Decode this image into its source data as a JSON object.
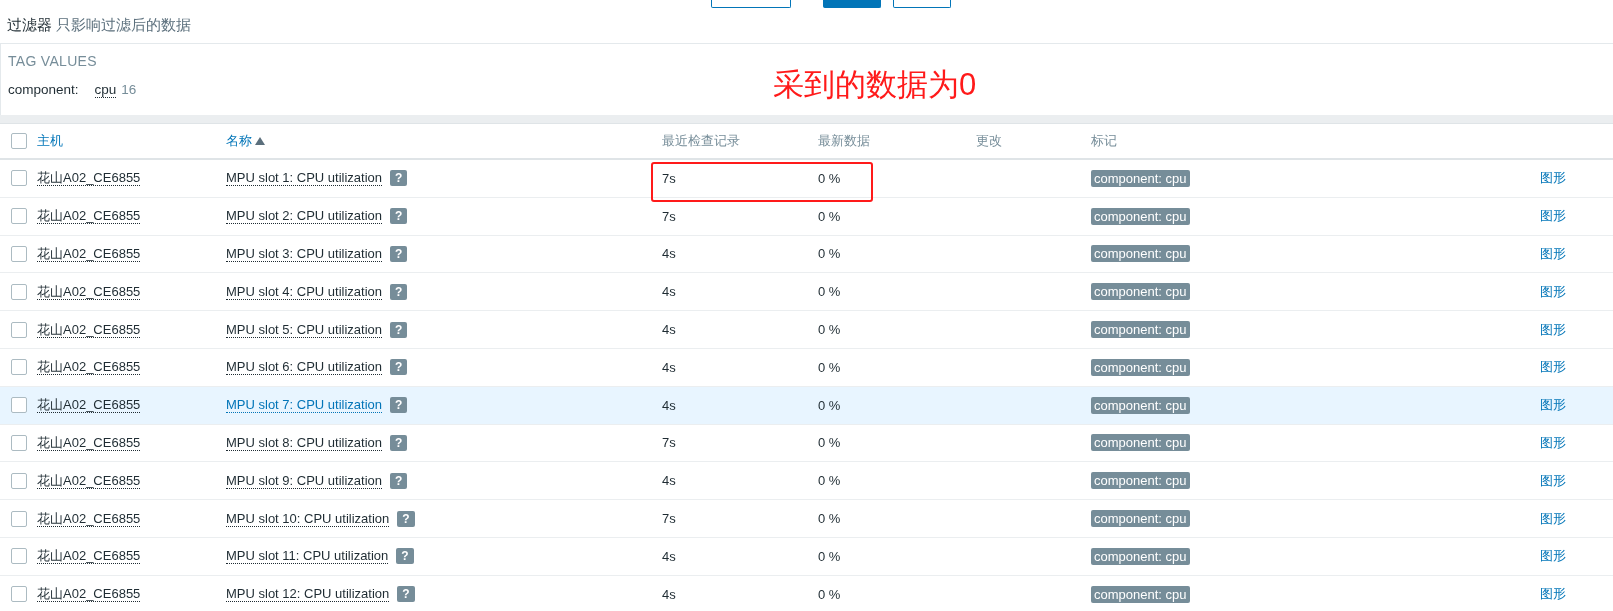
{
  "top_buttons": [
    {
      "kind": "outline"
    },
    {
      "kind": "primary"
    },
    {
      "kind": "outline"
    }
  ],
  "filter": {
    "title": "过滤器",
    "note": "只影响过滤后的数据"
  },
  "tag_values": {
    "heading": "TAG VALUES",
    "tags": [
      {
        "name": "component:",
        "value": "cpu",
        "count": "16"
      }
    ]
  },
  "annotation": {
    "text": "采到的数据为0"
  },
  "table": {
    "all_checked": false,
    "columns": [
      {
        "label": "主机",
        "kind": "link",
        "sorted": false
      },
      {
        "label": "名称",
        "kind": "link",
        "sorted": true
      },
      {
        "label": "最近检查记录",
        "kind": "plain",
        "sorted": false
      },
      {
        "label": "最新数据",
        "kind": "plain",
        "sorted": false
      },
      {
        "label": "更改",
        "kind": "plain",
        "sorted": false
      },
      {
        "label": "标记",
        "kind": "plain",
        "sorted": false
      }
    ],
    "rows": [
      {
        "host": "花山A02_CE6855",
        "name": "MPU slot 1: CPU utilization",
        "help": "?",
        "last_check": "7s",
        "last_value": "0 %",
        "tag": "component: cpu",
        "action": "图形",
        "checked": false,
        "highlighted": false
      },
      {
        "host": "花山A02_CE6855",
        "name": "MPU slot 2: CPU utilization",
        "help": "?",
        "last_check": "7s",
        "last_value": "0 %",
        "tag": "component: cpu",
        "action": "图形",
        "checked": false,
        "highlighted": false
      },
      {
        "host": "花山A02_CE6855",
        "name": "MPU slot 3: CPU utilization",
        "help": "?",
        "last_check": "4s",
        "last_value": "0 %",
        "tag": "component: cpu",
        "action": "图形",
        "checked": false,
        "highlighted": false
      },
      {
        "host": "花山A02_CE6855",
        "name": "MPU slot 4: CPU utilization",
        "help": "?",
        "last_check": "4s",
        "last_value": "0 %",
        "tag": "component: cpu",
        "action": "图形",
        "checked": false,
        "highlighted": false
      },
      {
        "host": "花山A02_CE6855",
        "name": "MPU slot 5: CPU utilization",
        "help": "?",
        "last_check": "4s",
        "last_value": "0 %",
        "tag": "component: cpu",
        "action": "图形",
        "checked": false,
        "highlighted": false
      },
      {
        "host": "花山A02_CE6855",
        "name": "MPU slot 6: CPU utilization",
        "help": "?",
        "last_check": "4s",
        "last_value": "0 %",
        "tag": "component: cpu",
        "action": "图形",
        "checked": false,
        "highlighted": false
      },
      {
        "host": "花山A02_CE6855",
        "name": "MPU slot 7: CPU utilization",
        "help": "?",
        "last_check": "4s",
        "last_value": "0 %",
        "tag": "component: cpu",
        "action": "图形",
        "checked": false,
        "highlighted": true
      },
      {
        "host": "花山A02_CE6855",
        "name": "MPU slot 8: CPU utilization",
        "help": "?",
        "last_check": "7s",
        "last_value": "0 %",
        "tag": "component: cpu",
        "action": "图形",
        "checked": false,
        "highlighted": false
      },
      {
        "host": "花山A02_CE6855",
        "name": "MPU slot 9: CPU utilization",
        "help": "?",
        "last_check": "4s",
        "last_value": "0 %",
        "tag": "component: cpu",
        "action": "图形",
        "checked": false,
        "highlighted": false
      },
      {
        "host": "花山A02_CE6855",
        "name": "MPU slot 10: CPU utilization",
        "help": "?",
        "last_check": "7s",
        "last_value": "0 %",
        "tag": "component: cpu",
        "action": "图形",
        "checked": false,
        "highlighted": false
      },
      {
        "host": "花山A02_CE6855",
        "name": "MPU slot 11: CPU utilization",
        "help": "?",
        "last_check": "4s",
        "last_value": "0 %",
        "tag": "component: cpu",
        "action": "图形",
        "checked": false,
        "highlighted": false
      },
      {
        "host": "花山A02_CE6855",
        "name": "MPU slot 12: CPU utilization",
        "help": "?",
        "last_check": "4s",
        "last_value": "0 %",
        "tag": "component: cpu",
        "action": "图形",
        "checked": false,
        "highlighted": false
      }
    ]
  }
}
